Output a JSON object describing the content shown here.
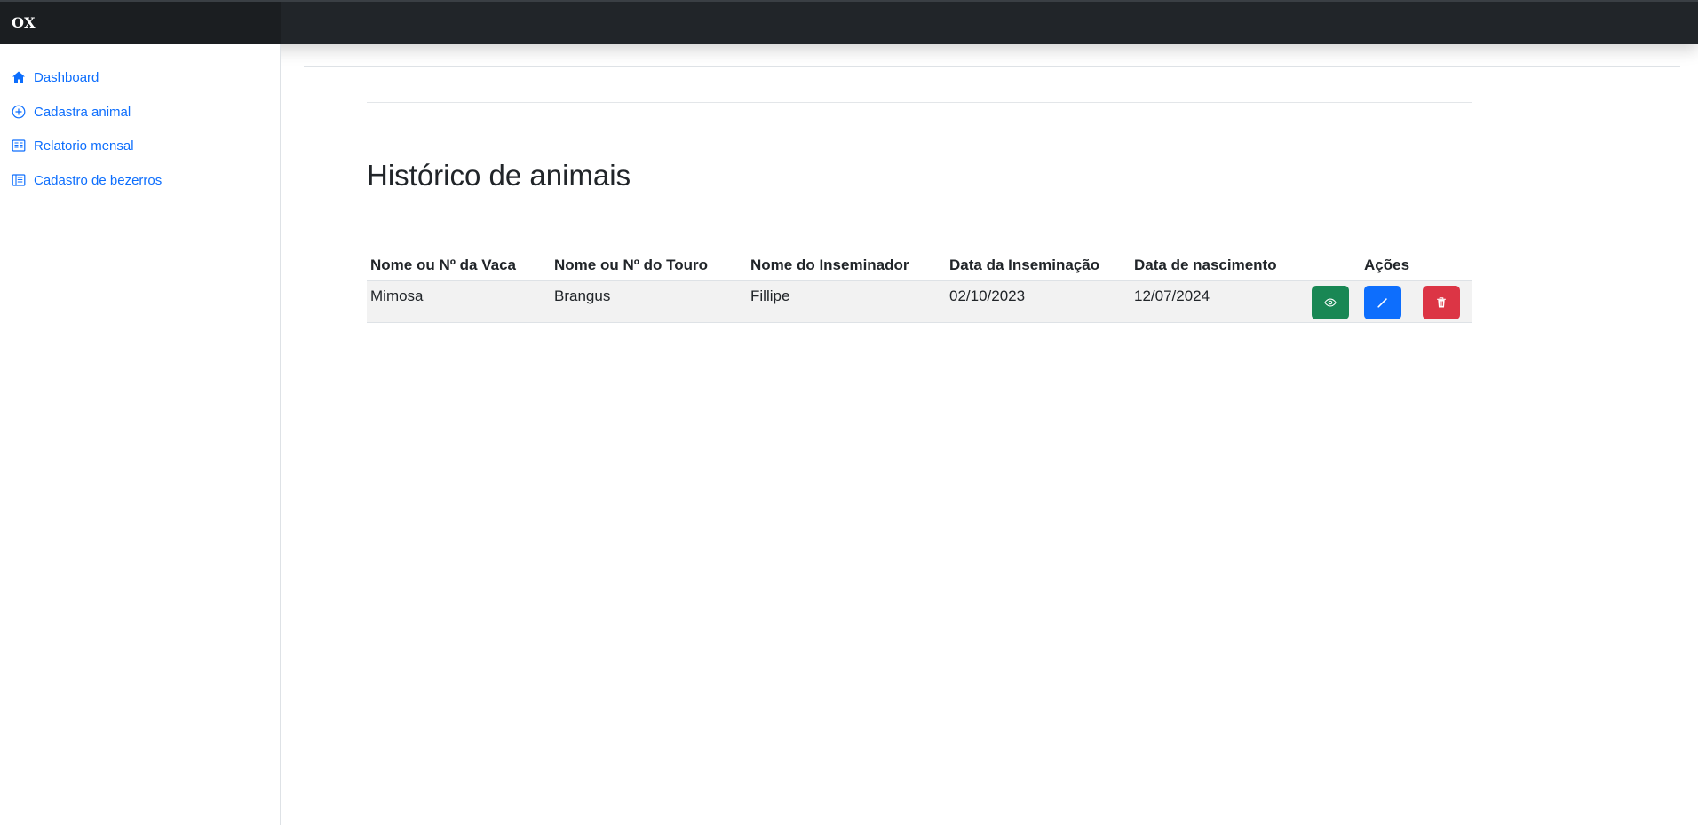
{
  "brand": {
    "title": "OX"
  },
  "sidebar": {
    "items": [
      {
        "label": "Dashboard",
        "icon": "house-icon"
      },
      {
        "label": "Cadastra animal",
        "icon": "plus-circle-icon"
      },
      {
        "label": "Relatorio mensal",
        "icon": "report-icon"
      },
      {
        "label": "Cadastro de bezerros",
        "icon": "list-book-icon"
      }
    ]
  },
  "main": {
    "title": "Histórico de animais",
    "table": {
      "headers": [
        "Nome ou Nº da Vaca",
        "Nome ou Nº do Touro",
        "Nome do Inseminador",
        "Data da Inseminação",
        "Data de nascimento",
        "Ações"
      ],
      "rows": [
        {
          "vaca": "Mimosa",
          "touro": "Brangus",
          "inseminador": "Fillipe",
          "data_inseminacao": "02/10/2023",
          "data_nascimento": "12/07/2024"
        }
      ],
      "actions": [
        {
          "name": "view",
          "icon": "eye-icon",
          "color": "#198754"
        },
        {
          "name": "edit",
          "icon": "pencil-icon",
          "color": "#0d6efd"
        },
        {
          "name": "delete",
          "icon": "trash-icon",
          "color": "#dc3545"
        }
      ]
    }
  },
  "colors": {
    "link": "#0d6efd",
    "topbar": "#212529"
  }
}
